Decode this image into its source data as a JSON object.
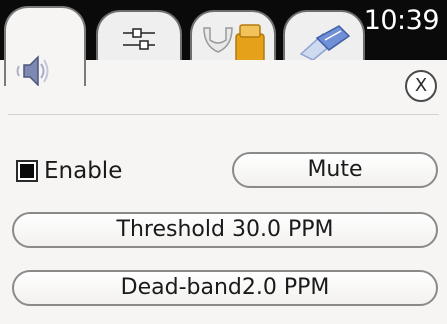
{
  "status": {
    "clock": "10:39"
  },
  "tabs": [
    {
      "icon": "speaker-icon",
      "active": true
    },
    {
      "icon": "sliders-icon",
      "active": false
    },
    {
      "icon": "tools-icon",
      "active": false
    },
    {
      "icon": "comm-icon",
      "active": false
    }
  ],
  "dialog": {
    "close_label": "X"
  },
  "controls": {
    "enable_label": "Enable",
    "enable_checked": true,
    "mute_label": "Mute",
    "threshold_label": "Threshold 30.0 PPM",
    "deadband_label": "Dead-band2.0 PPM"
  },
  "colors": {
    "tabbar_bg": "#0a0a0a",
    "panel_bg": "#f6f5f3",
    "speaker_accent": "#7d88b3",
    "tool_accent": "#e5a11a",
    "comm_accent": "#6f8fd6"
  }
}
